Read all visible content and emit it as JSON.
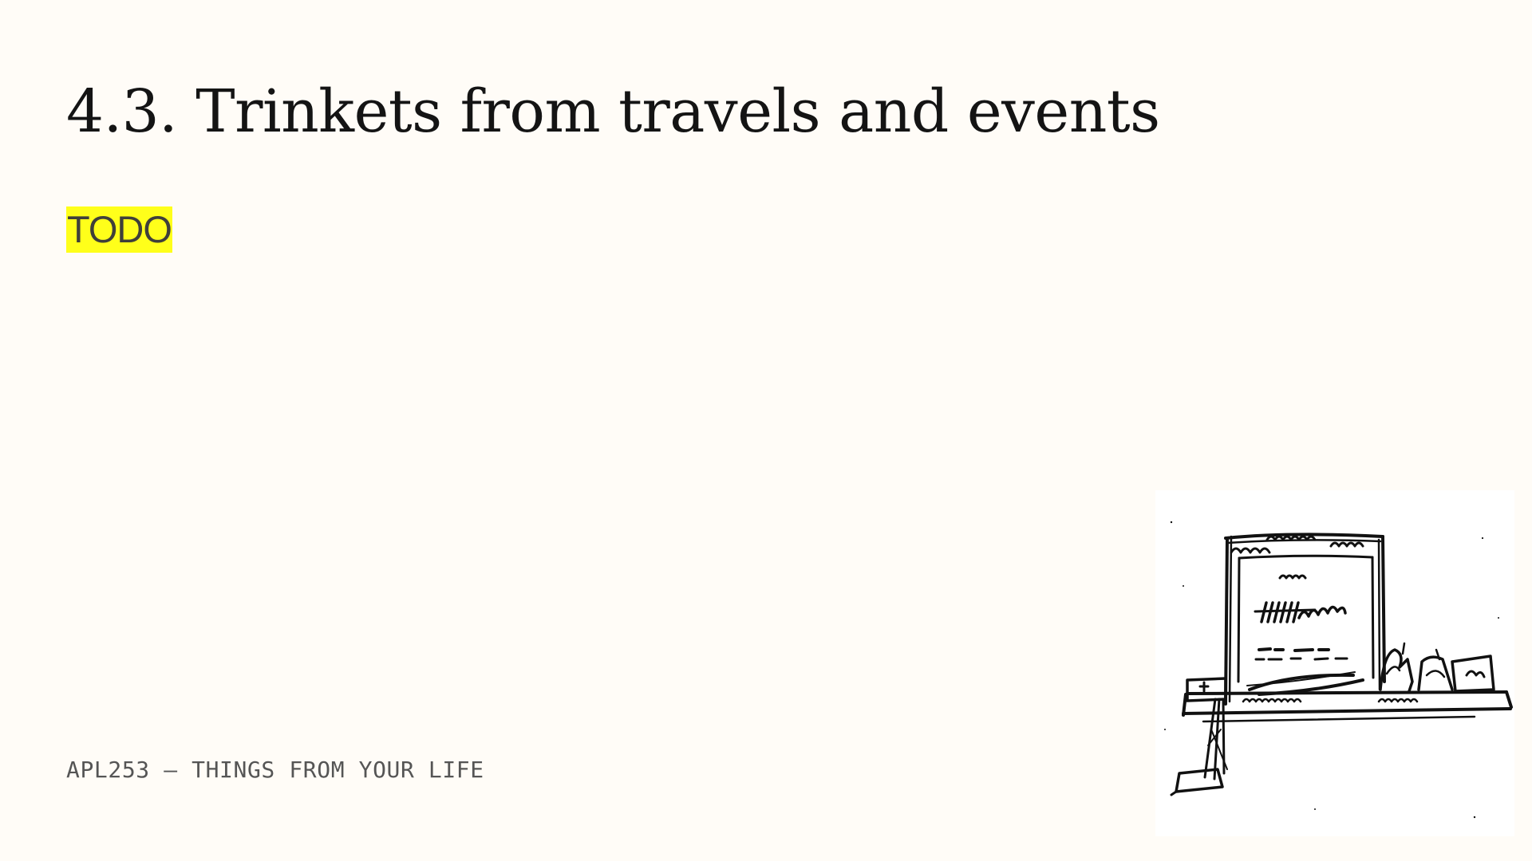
{
  "slide": {
    "title": "4.3. Trinkets from travels and events",
    "todo_label": "TODO",
    "footer_label": "APL253 – THINGS FROM YOUR LIFE"
  },
  "colors": {
    "background": "#fffcf7",
    "todo_highlight": "#ffff1a",
    "title_text": "#141414",
    "footer_text": "#555555",
    "sketch_ink": "#111111"
  },
  "illustration": {
    "subject": "hand-drawn ink sketch of a framed board on a shelf with small trinkets"
  }
}
